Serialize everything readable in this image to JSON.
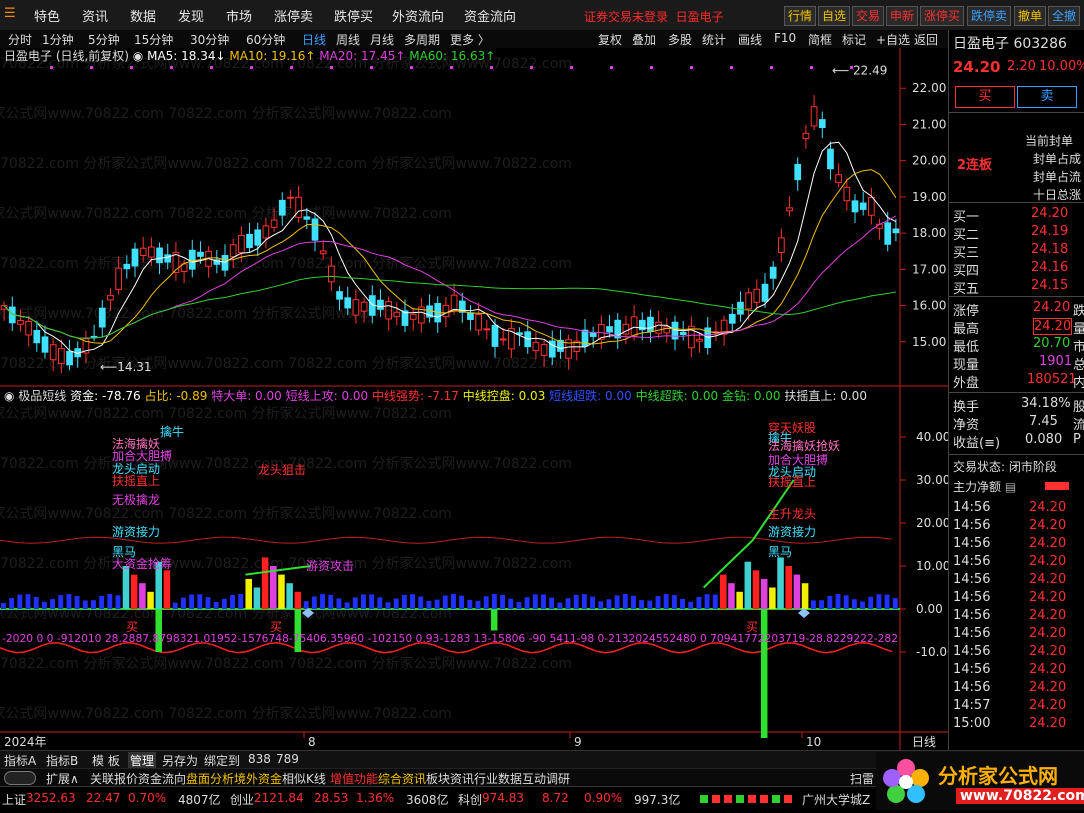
{
  "menu": [
    "特色",
    "资讯",
    "数据",
    "发现",
    "市场",
    "涨停卖",
    "跌停买",
    "外资流向",
    "资金流向"
  ],
  "warning": "证券交易未登录",
  "warning_stock": "日盈电子",
  "top_buttons": [
    {
      "label": "行情",
      "color": "#f0c000"
    },
    {
      "label": "自选",
      "color": "#f0c000"
    },
    {
      "label": "交易",
      "color": "#ff3030"
    },
    {
      "label": "申新",
      "color": "#ff3030"
    },
    {
      "label": "涨停买",
      "color": "#ff3030"
    },
    {
      "label": "跌停卖",
      "color": "#3aa0ff"
    },
    {
      "label": "撤单",
      "color": "#f0c000"
    },
    {
      "label": "全撤",
      "color": "#3aa0ff"
    }
  ],
  "period_tabs": [
    "分时",
    "1分钟",
    "5分钟",
    "15分钟",
    "30分钟",
    "60分钟",
    "日线",
    "周线",
    "月线",
    "多周期",
    "更多 〉"
  ],
  "active_period": "日线",
  "tool_buttons": [
    "复权",
    "叠加",
    "多股",
    "统计",
    "画线",
    "F10",
    "简框",
    "标记",
    "+自选",
    "返回"
  ],
  "chart_title": "日盈电子 (日线,前复权)",
  "ma": [
    {
      "label": "MA5: 18.34",
      "color": "#ffffff"
    },
    {
      "label": "MA10: 19.16",
      "color": "#f0c000"
    },
    {
      "label": "MA20: 17.45",
      "color": "#e040e0"
    },
    {
      "label": "MA60: 16.63",
      "color": "#30d030"
    }
  ],
  "price_axis": [
    "22.00",
    "21.00",
    "20.00",
    "19.00",
    "18.00",
    "17.00",
    "16.00",
    "15.00"
  ],
  "high_label": "22.49",
  "low_label": "14.31",
  "indicator_title": "极品短线",
  "indicator_values": [
    {
      "label": "资金: -78.76",
      "color": "#ffffff"
    },
    {
      "label": "占比: -0.89",
      "color": "#f0c000"
    },
    {
      "label": "特大单: 0.00",
      "color": "#e040e0"
    },
    {
      "label": "短线上攻: 0.00",
      "color": "#e040e0"
    },
    {
      "label": "中线强势: -7.17",
      "color": "#ff3030"
    },
    {
      "label": "中线控盘: 0.03",
      "color": "#f0f000"
    },
    {
      "label": "短线超跌: 0.00",
      "color": "#3050ff"
    },
    {
      "label": "中线超跌: 0.00",
      "color": "#30d030"
    },
    {
      "label": "金钻: 0.00",
      "color": "#30d030"
    },
    {
      "label": "扶摇直上: 0.00",
      "color": "#dddddd"
    }
  ],
  "ind_axis": [
    "40.00",
    "30.00",
    "20.00",
    "10.00",
    "0.00",
    "-10.00"
  ],
  "signals_left": [
    {
      "text": "擒牛",
      "color": "#40e0ff"
    },
    {
      "text": "法海擒妖",
      "color": "#ff70c0"
    },
    {
      "text": "加合大胆搏",
      "color": "#e040e0"
    },
    {
      "text": "龙头启动",
      "color": "#40e0ff"
    },
    {
      "text": "扶摇直上",
      "color": "#ff3030"
    },
    {
      "text": "无极擒龙",
      "color": "#e040e0"
    },
    {
      "text": "游资接力",
      "color": "#40e0ff"
    },
    {
      "text": "黑马",
      "color": "#40e0ff"
    },
    {
      "text": "大资金抢筹",
      "color": "#e040e0"
    }
  ],
  "signal_mid": [
    {
      "text": "龙头狙击",
      "color": "#ff3030"
    },
    {
      "text": "游资攻击",
      "color": "#e040e0"
    }
  ],
  "signals_right": [
    {
      "text": "穿天妖股",
      "color": "#ff3030"
    },
    {
      "text": "擒牛",
      "color": "#40e0ff"
    },
    {
      "text": "法海擒妖抢妖",
      "color": "#ff70c0"
    },
    {
      "text": "加合大胆搏",
      "color": "#e040e0"
    },
    {
      "text": "龙头启动",
      "color": "#40e0ff"
    },
    {
      "text": "扶摇直上",
      "color": "#ff3030"
    },
    {
      "text": "主升龙头",
      "color": "#ff3030"
    },
    {
      "text": "游资接力",
      "color": "#40e0ff"
    },
    {
      "text": "黑马",
      "color": "#40e0ff"
    }
  ],
  "buy_marks": [
    "买",
    "买",
    "买"
  ],
  "bottom_numbers": "-2020  0  0  -912010  28.2887.8798321.01952-1576748-75406.35960  -102150  0.93-1283  13-15806  -90  5411-98  0-2132024552480  0  70941772203719-28.8229222-282",
  "time_axis": [
    "2024年",
    "8",
    "9",
    "10",
    "日线"
  ],
  "stock": {
    "name": "日盈电子",
    "code": "603286",
    "price": "24.20",
    "change": "2.20",
    "pct": "10.00%"
  },
  "trade_buttons": {
    "buy": "买",
    "sell": "卖"
  },
  "limit_info": {
    "tag": "2连板",
    "lines": [
      "当前封单",
      "封单占成",
      "封单占流",
      "十日总涨"
    ]
  },
  "bids": [
    {
      "label": "买一",
      "price": "24.20"
    },
    {
      "label": "买二",
      "price": "24.19"
    },
    {
      "label": "买三",
      "price": "24.18"
    },
    {
      "label": "买四",
      "price": "24.16"
    },
    {
      "label": "买五",
      "price": "24.15"
    }
  ],
  "stats": [
    {
      "label": "涨停",
      "value": "24.20",
      "color": "#ff3030",
      "suffix": "跌"
    },
    {
      "label": "最高",
      "value": "24.20",
      "color": "#ff3030",
      "suffix": "量"
    },
    {
      "label": "最低",
      "value": "20.70",
      "color": "#30d030",
      "suffix": "市"
    },
    {
      "label": "现量",
      "value": "1901",
      "color": "#e040e0",
      "suffix": "总"
    },
    {
      "label": "外盘",
      "value": "180521",
      "color": "#ff3030",
      "suffix": "内"
    }
  ],
  "stats2": [
    {
      "label": "换手",
      "value": "34.18%",
      "suffix": "股"
    },
    {
      "label": "净资",
      "value": "7.45",
      "suffix": "流"
    },
    {
      "label": "收益(≡)",
      "value": "0.080",
      "suffix": "P"
    }
  ],
  "trade_state": "交易状态: 闭市阶段",
  "net_flow": "主力净额",
  "ticks": [
    {
      "t": "14:56",
      "p": "24.20"
    },
    {
      "t": "14:56",
      "p": "24.20"
    },
    {
      "t": "14:56",
      "p": "24.20"
    },
    {
      "t": "14:56",
      "p": "24.20"
    },
    {
      "t": "14:56",
      "p": "24.20"
    },
    {
      "t": "14:56",
      "p": "24.20"
    },
    {
      "t": "14:56",
      "p": "24.20"
    },
    {
      "t": "14:56",
      "p": "24.20"
    },
    {
      "t": "14:56",
      "p": "24.20"
    },
    {
      "t": "14:56",
      "p": "24.20"
    },
    {
      "t": "14:56",
      "p": "24.20"
    },
    {
      "t": "14:57",
      "p": "24.20"
    },
    {
      "t": "15:00",
      "p": "24.20"
    }
  ],
  "bottom_tabs": [
    "指标A",
    "指标B",
    "模 板",
    "管理",
    "另存为",
    "绑定到",
    "838",
    "789"
  ],
  "func_tabs": [
    {
      "label": "扩展∧",
      "color": "#ddd"
    },
    {
      "label": "关联报价",
      "color": "#ddd"
    },
    {
      "label": "资金流向",
      "color": "#ddd"
    },
    {
      "label": "盘面分析",
      "color": "#f0c000"
    },
    {
      "label": "境外资金",
      "color": "#f0c000"
    },
    {
      "label": "相似K线",
      "color": "#ddd"
    },
    {
      "label": "增值功能",
      "color": "#ff3030"
    },
    {
      "label": "综合资讯",
      "color": "#f0c000"
    },
    {
      "label": "板块资讯",
      "color": "#ddd"
    },
    {
      "label": "行业数据",
      "color": "#ddd"
    },
    {
      "label": "互动调研",
      "color": "#ddd"
    },
    {
      "label": "扫雷宝",
      "color": "#ddd"
    },
    {
      "label": "图文",
      "color": "#ddd"
    }
  ],
  "status": [
    {
      "label": "上证",
      "value": "3252.63",
      "chg": "22.47",
      "pct": "0.70%",
      "amt": "4807亿"
    },
    {
      "label": "创业",
      "value": "2121.84",
      "chg": "28.53",
      "pct": "1.36%",
      "amt": "3608亿"
    },
    {
      "label": "科创",
      "value": "974.83",
      "chg": "8.72",
      "pct": "0.90%",
      "amt": "997.3亿"
    }
  ],
  "status_right": "广州大学城Z",
  "watermark": "70822.com 分析家公式网www.70822.com",
  "logo_text": "分析家公式网",
  "logo_url": "www.70822.com",
  "colors": {
    "up": "#ff3030",
    "down": "#40e0ff",
    "ma5": "#ffffff",
    "ma10": "#f0c000",
    "ma20": "#e040e0",
    "ma60": "#30d030"
  }
}
